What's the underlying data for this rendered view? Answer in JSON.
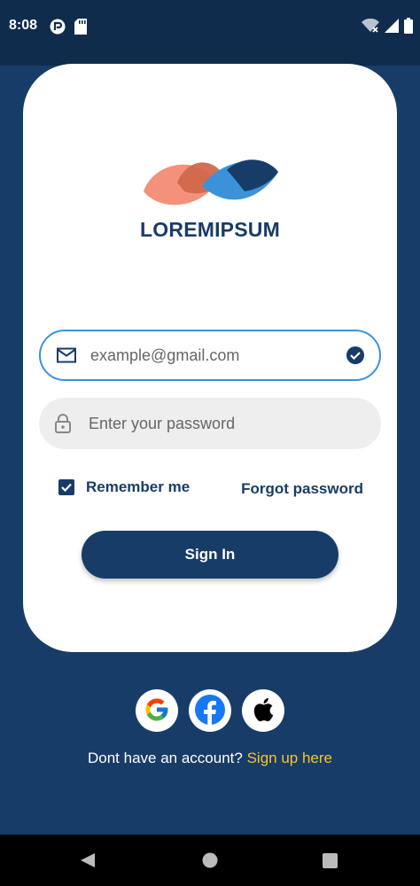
{
  "status_bar": {
    "time": "8:08",
    "left_icons": [
      "app-notification-icon",
      "sd-card-icon"
    ],
    "right_icons": [
      "wifi-off-icon",
      "signal-icon",
      "battery-icon"
    ]
  },
  "brand": {
    "name": "LOREMIPSUM",
    "colors": {
      "primary": "#183c68",
      "accent": "#3a93d8",
      "salmon": "#f4917a",
      "link": "#f7c32e"
    }
  },
  "login_form": {
    "email": {
      "value": "example@gmail.com",
      "placeholder": "example@gmail.com",
      "icon": "mail-icon",
      "valid": true
    },
    "password": {
      "value": "",
      "placeholder": "Enter your password",
      "icon": "lock-icon"
    },
    "remember_me": {
      "label": "Remember me",
      "checked": true
    },
    "forgot_password_label": "Forgot password",
    "sign_in_label": "Sign In"
  },
  "social_login": {
    "providers": [
      "google",
      "facebook",
      "apple"
    ]
  },
  "signup": {
    "prompt": "Dont have an account?",
    "link_label": "Sign up here"
  },
  "nav_bar": {
    "buttons": [
      "back",
      "home",
      "recents"
    ]
  }
}
